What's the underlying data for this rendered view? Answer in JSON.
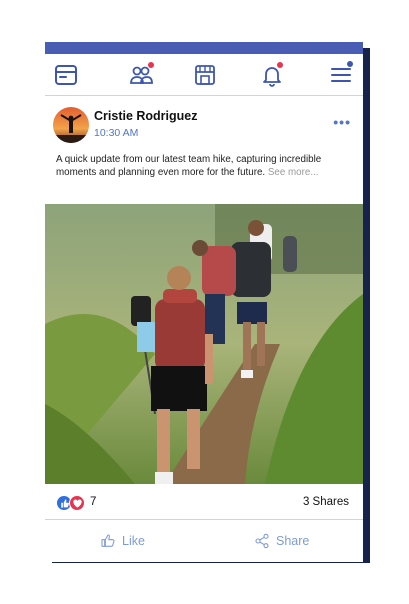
{
  "nav": {
    "items": [
      {
        "icon": "browser-window-icon",
        "badge": false
      },
      {
        "icon": "friends-icon",
        "badge": true
      },
      {
        "icon": "marketplace-store-icon",
        "badge": false
      },
      {
        "icon": "notification-bell-icon",
        "badge": true
      },
      {
        "icon": "menu-hamburger-icon",
        "badge": true
      }
    ],
    "accent": "#4a5db5",
    "badge_color": "#e8344f"
  },
  "post": {
    "author": "Cristie Rodriguez",
    "time": "10:30 AM",
    "more_label": "•••",
    "caption": "A quick update from our latest team hike, capturing incredible moments and planning even more for the future.",
    "see_more": "See more...",
    "image": "group-of-hikers-walking-up-grassy-trail"
  },
  "stats": {
    "reactions": [
      "like",
      "love"
    ],
    "reaction_count": "7",
    "shares": "3 Shares"
  },
  "actions": {
    "like_label": "Like",
    "share_label": "Share",
    "color": "#7f9bd8"
  }
}
